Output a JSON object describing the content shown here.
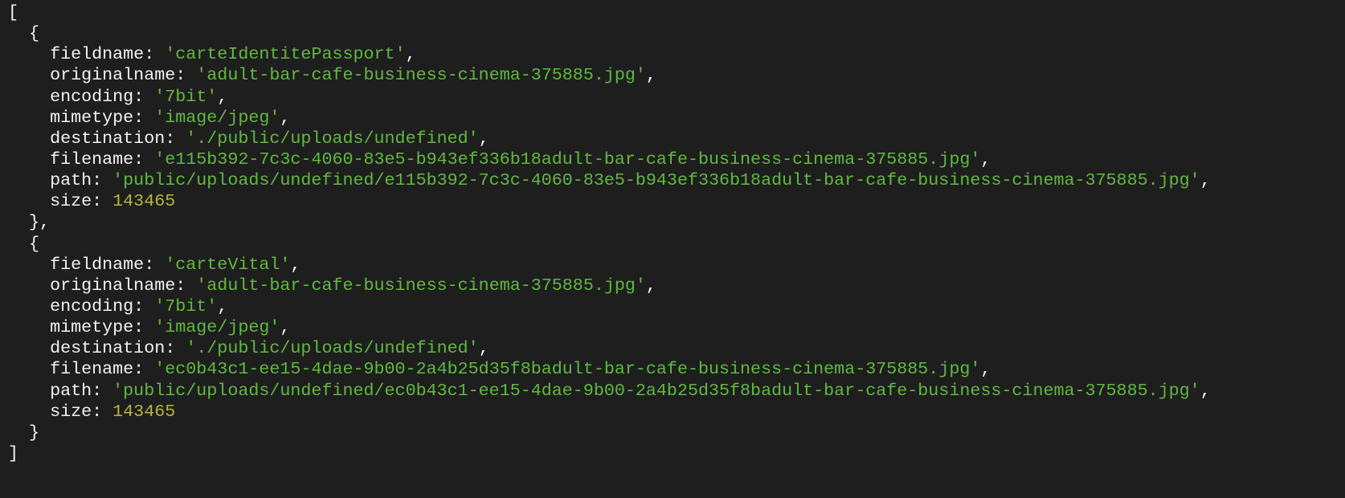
{
  "output": [
    {
      "fieldname": "carteIdentitePassport",
      "originalname": "adult-bar-cafe-business-cinema-375885.jpg",
      "encoding": "7bit",
      "mimetype": "image/jpeg",
      "destination": "./public/uploads/undefined",
      "filename": "e115b392-7c3c-4060-83e5-b943ef336b18adult-bar-cafe-business-cinema-375885.jpg",
      "path": "public/uploads/undefined/e115b392-7c3c-4060-83e5-b943ef336b18adult-bar-cafe-business-cinema-375885.jpg",
      "size": "143465"
    },
    {
      "fieldname": "carteVital",
      "originalname": "adult-bar-cafe-business-cinema-375885.jpg",
      "encoding": "7bit",
      "mimetype": "image/jpeg",
      "destination": "./public/uploads/undefined",
      "filename": "ec0b43c1-ee15-4dae-9b00-2a4b25d35f8badult-bar-cafe-business-cinema-375885.jpg",
      "path": "public/uploads/undefined/ec0b43c1-ee15-4dae-9b00-2a4b25d35f8badult-bar-cafe-business-cinema-375885.jpg",
      "size": "143465"
    }
  ],
  "colors": {
    "background": "#1e1e1e",
    "string": "#5fba3f",
    "number": "#b9b43c",
    "text": "#f2f2f2"
  }
}
